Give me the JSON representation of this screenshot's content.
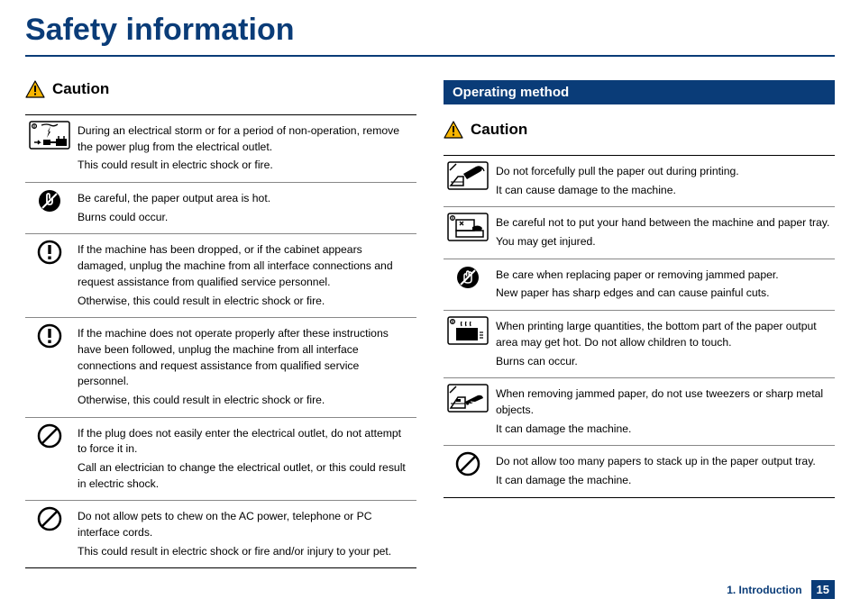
{
  "title": "Safety information",
  "caution_label": "Caution",
  "section_operating": "Operating method",
  "left": [
    {
      "icon": "storm-plug",
      "lines": [
        "During an electrical storm or for a period of non-operation, remove the power plug from the electrical outlet.",
        "This could result in electric shock or fire."
      ]
    },
    {
      "icon": "no-touch",
      "lines": [
        "Be careful, the paper output area is hot.",
        "Burns could occur."
      ]
    },
    {
      "icon": "alert-circle",
      "lines": [
        "If the machine has been dropped, or if the cabinet appears damaged, unplug the machine from all interface connections and request assistance from qualified service personnel.",
        "Otherwise, this could result in electric shock or fire."
      ]
    },
    {
      "icon": "alert-circle",
      "lines": [
        "If the machine does not operate properly after these instructions have been followed, unplug the machine from all interface connections and request assistance from qualified service personnel.",
        "Otherwise, this could result in electric shock or fire."
      ]
    },
    {
      "icon": "prohibit",
      "lines": [
        "If the plug does not easily enter the electrical outlet, do not attempt to force it in.",
        "Call an electrician to change the electrical outlet, or this could result in electric shock."
      ]
    },
    {
      "icon": "prohibit",
      "lines": [
        "Do not allow pets to chew on the AC power, telephone or PC interface cords.",
        "This could result in electric shock or fire and/or injury to your pet."
      ]
    }
  ],
  "right": [
    {
      "icon": "pull-paper",
      "lines": [
        "Do not forcefully pull the paper out during printing.",
        "It can cause damage to the machine."
      ]
    },
    {
      "icon": "hand-tray",
      "lines": [
        "Be careful not to put your hand between the machine and paper tray.",
        "You may get injured."
      ]
    },
    {
      "icon": "no-hand",
      "lines": [
        "Be care when replacing paper or removing jammed paper.",
        "New paper has sharp edges and can cause painful cuts."
      ]
    },
    {
      "icon": "printer-hot",
      "lines": [
        "When printing large quantities, the bottom part of the paper output area may get hot. Do not allow children to touch.",
        "Burns can occur."
      ]
    },
    {
      "icon": "tweezers",
      "lines": [
        "When removing jammed paper, do not use tweezers or sharp metal objects.",
        "It can damage the machine."
      ]
    },
    {
      "icon": "prohibit",
      "lines": [
        "Do not allow too many papers to stack up in the paper output tray.",
        "It can damage the machine."
      ]
    }
  ],
  "footer_chapter": "1. Introduction",
  "footer_page": "15"
}
